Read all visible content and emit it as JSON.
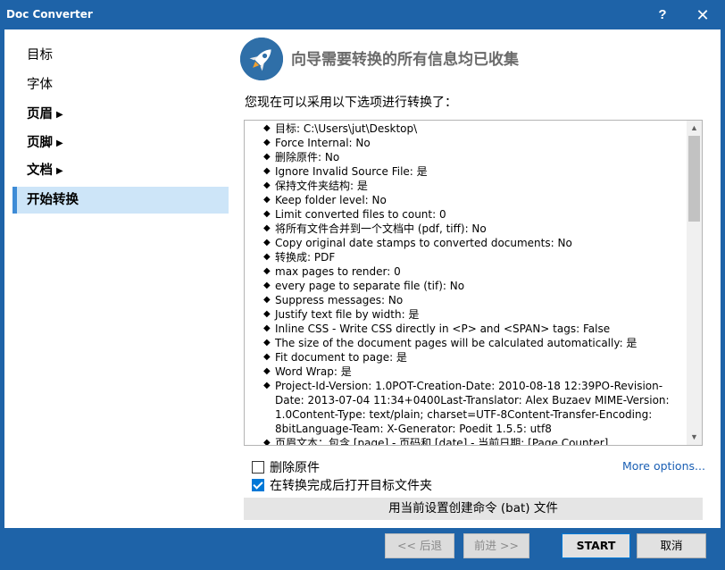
{
  "window": {
    "title": "Doc Converter",
    "help_label": "?",
    "close_label": "✕"
  },
  "sidebar": {
    "items": [
      {
        "label": "目标",
        "has_arrow": false
      },
      {
        "label": "字体",
        "has_arrow": false
      },
      {
        "label": "页眉",
        "has_arrow": true
      },
      {
        "label": "页脚",
        "has_arrow": true
      },
      {
        "label": "文档",
        "has_arrow": true
      },
      {
        "label": "开始转换",
        "has_arrow": false,
        "active": true
      }
    ],
    "arrow_glyph": "▶"
  },
  "header": {
    "title": "向导需要转换的所有信息均已收集",
    "logo_icon": "rocket-icon"
  },
  "subtitle": "您现在可以采用以下选项进行转换了：",
  "options_list": [
    "目标: C:\\Users\\jut\\Desktop\\",
    "Force Internal: No",
    "删除原件: No",
    "Ignore Invalid Source File: 是",
    "保持文件夹结构: 是",
    "Keep folder level: No",
    "Limit converted files to count: 0",
    "将所有文件合并到一个文档中 (pdf, tiff): No",
    "Copy original date stamps to converted documents: No",
    "转换成: PDF",
    "max pages to render: 0",
    "every page to separate file (tif): No",
    "Suppress messages: No",
    "Justify text file by width: 是",
    "Inline CSS - Write CSS directly in <P> and <SPAN> tags: False",
    "The size of the document pages will be calculated automatically: 是",
    "Fit document to page: 是",
    "Word Wrap: 是",
    "Project-Id-Version: 1.0POT-Creation-Date: 2010-08-18 12:39PO-Revision-Date: 2013-07-04 11:34+0400Last-Translator: Alex Buzaev MIME-Version: 1.0Content-Type: text/plain; charset=UTF-8Content-Transfer-Encoding: 8bitLanguage-Team: X-Generator: Poedit 1.5.5: utf8",
    "页眉文本：包含 [page] - 页码和 [date] - 当前日期: [Page Counter]"
  ],
  "bullet_glyph": "◆",
  "scrollbar": {
    "up_icon": "▲",
    "down_icon": "▼"
  },
  "checkboxes": {
    "delete_original": {
      "label": "删除原件",
      "checked": false
    },
    "open_folder": {
      "label": "在转换完成后打开目标文件夹",
      "checked": true
    }
  },
  "more_options_label": "More options...",
  "create_batch_label": "用当前设置创建命令 (bat) 文件",
  "footer": {
    "back_label": "<< 后退",
    "next_label": "前进 >>",
    "start_label": "START",
    "cancel_label": "取消"
  }
}
